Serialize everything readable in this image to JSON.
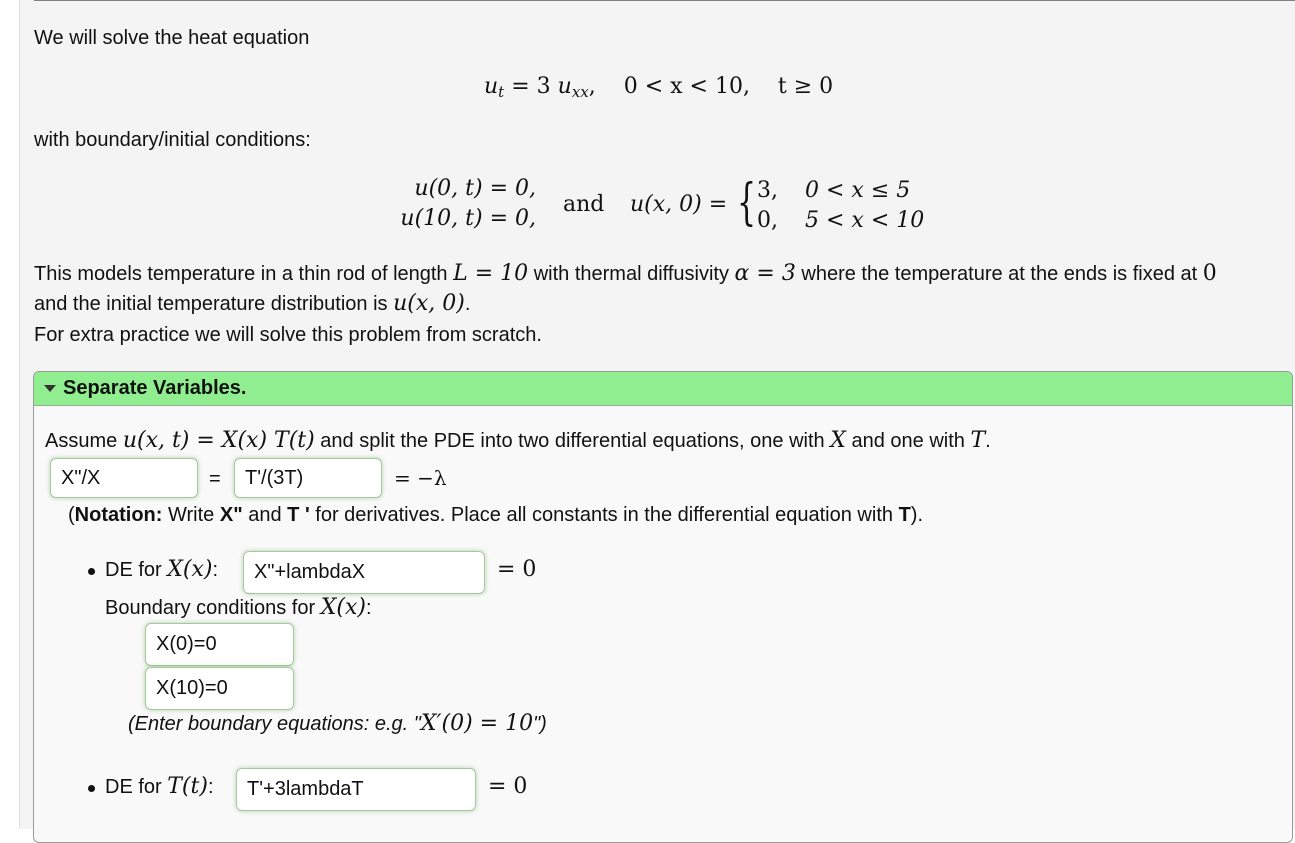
{
  "intro": {
    "line1": "We will solve the heat equation",
    "pde": {
      "lhs": "u",
      "lhs_sub": "t",
      "eq": "= 3",
      "rhs": "u",
      "rhs_sub": "xx",
      "domain": "0 < x < 10,",
      "time": "t ≥ 0"
    },
    "line2": "with boundary/initial conditions:",
    "bc1": "u(0, t) = 0,",
    "bc2": "u(10, t) = 0,",
    "and": "and",
    "ic_lhs": "u(x, 0) =",
    "cases": [
      {
        "value": "3,",
        "condition": "0 < x ≤ 5"
      },
      {
        "value": "0,",
        "condition": "5 < x < 10"
      }
    ],
    "model_text_1": "This models temperature in a thin rod of length",
    "model_L": "L = 10",
    "model_text_2": "with thermal diffusivity",
    "model_alpha": "α = 3",
    "model_text_3": "where the temperature at the ends is fixed at",
    "model_zero": "0",
    "model_text_4": "and the initial temperature distribution is",
    "model_u": "u(x, 0)",
    "model_text_5": ".",
    "practice": "For extra practice we will solve this problem from scratch."
  },
  "section": {
    "title": "Separate Variables.",
    "assume_1": "Assume",
    "assume_math": "u(x, t) = X(x) T(t)",
    "assume_2": "and split the PDE into two differential equations, one with",
    "assume_X": "X",
    "assume_3": "and one with",
    "assume_T": "T",
    "assume_4": ".",
    "ratio_x": "X\"/X",
    "eq_sign": "=",
    "ratio_t": "T'/(3T)",
    "eq_lambda": "= −λ",
    "notation_open": "(",
    "notation_label": "Notation:",
    "notation_1": " Write ",
    "notation_X": "X\"",
    "notation_2": " and ",
    "notation_T": "T '",
    "notation_3": " for derivatives. Place all constants in the differential equation with ",
    "notation_T2": "T",
    "notation_close": ").",
    "de_x_label": "DE for",
    "de_x_fn": "X(x)",
    "de_x_value": "X\"+lambdaX",
    "eq_zero": "= 0",
    "bc_label": "Boundary conditions for",
    "bc_fn": "X(x)",
    "bc1_value": "X(0)=0",
    "bc2_value": "X(10)=0",
    "bc_hint_1": "(Enter boundary equations: e.g. \"",
    "bc_hint_math": "X′(0) = 10",
    "bc_hint_2": "\")",
    "de_t_label": "DE for",
    "de_t_fn": "T(t)",
    "de_t_value": "T'+3lambdaT"
  }
}
